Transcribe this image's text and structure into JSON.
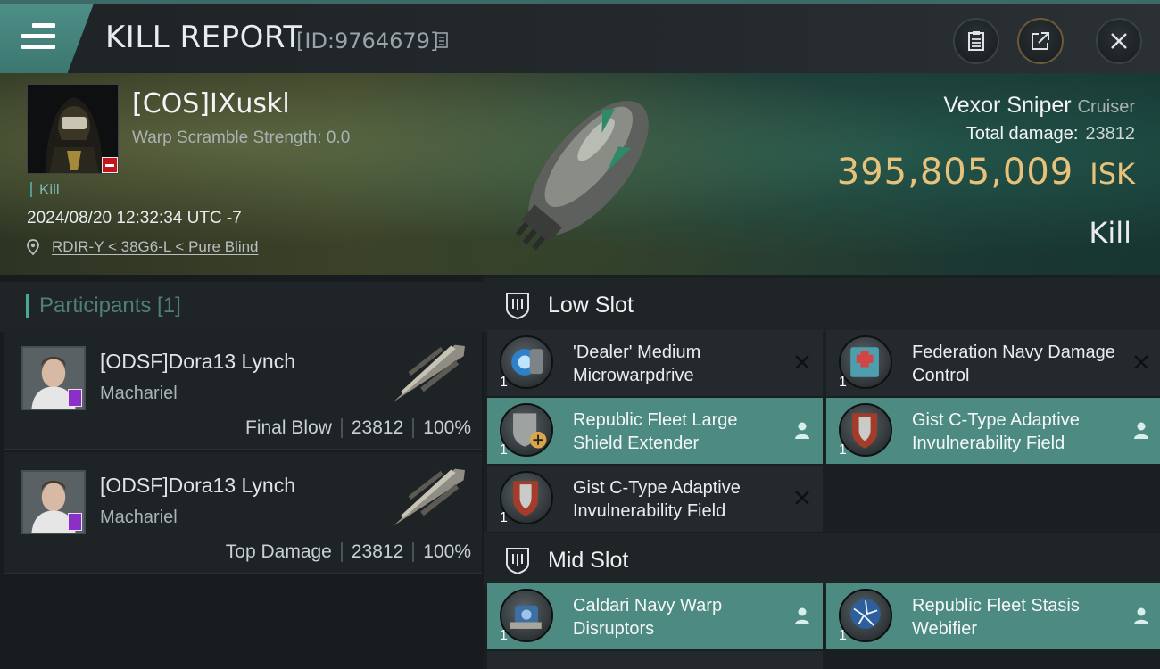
{
  "header": {
    "title": "KILL REPORT",
    "report_id": "[ID:9764679]"
  },
  "victim": {
    "name": "[COS]IXuskl",
    "warp_scramble": "Warp Scramble Strength: 0.0",
    "kill_tag": "Kill",
    "datetime": "2024/08/20 12:32:34 UTC -7",
    "location": "RDIR-Y < 38G6-L < Pure Blind",
    "ship_name": "Vexor Sniper",
    "ship_class": "Cruiser",
    "total_damage_label": "Total damage:",
    "total_damage_value": "23812",
    "isk_value": "395,805,009",
    "isk_unit": "ISK",
    "result": "Kill"
  },
  "participants": {
    "header": "Participants [1]",
    "rows": [
      {
        "name": "[ODSF]Dora13 Lynch",
        "ship": "Machariel",
        "role": "Final Blow",
        "damage": "23812",
        "percent": "100%"
      },
      {
        "name": "[ODSF]Dora13 Lynch",
        "ship": "Machariel",
        "role": "Top Damage",
        "damage": "23812",
        "percent": "100%"
      }
    ]
  },
  "fitting": {
    "low_slot": {
      "label": "Low Slot",
      "modules": [
        {
          "name": "'Dealer' Medium Microwarpdrive",
          "qty": "1",
          "state": "destroyed"
        },
        {
          "name": "Federation Navy Damage Control",
          "qty": "1",
          "state": "destroyed"
        },
        {
          "name": "Republic Fleet Large Shield Extender",
          "qty": "1",
          "state": "dropped"
        },
        {
          "name": "Gist C-Type Adaptive Invulnerability Field",
          "qty": "1",
          "state": "dropped"
        },
        {
          "name": "Gist C-Type Adaptive Invulnerability Field",
          "qty": "1",
          "state": "destroyed"
        }
      ]
    },
    "mid_slot": {
      "label": "Mid Slot",
      "modules": [
        {
          "name": "Caldari Navy Warp Disruptors",
          "qty": "1",
          "state": "dropped"
        },
        {
          "name": "Republic Fleet Stasis Webifier",
          "qty": "1",
          "state": "dropped"
        }
      ]
    }
  },
  "colors": {
    "accent_teal": "#4c8a82",
    "isk_gold": "#e8c27a",
    "negative_red": "#c2161b",
    "corp_purple": "#8b2fc6"
  }
}
